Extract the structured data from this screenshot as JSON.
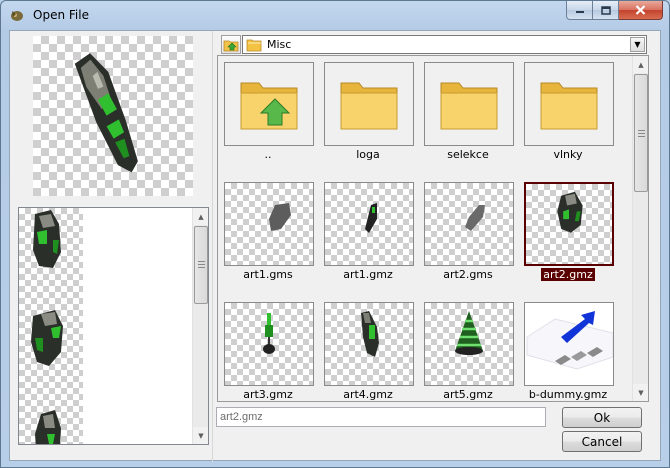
{
  "window": {
    "title": "Open File",
    "controls": {
      "minimize_icon": "minimize-icon",
      "maximize_icon": "maximize-icon",
      "close_icon": "close-icon"
    }
  },
  "toolbar": {
    "up_icon": "folder-up-icon",
    "path": "Misc"
  },
  "files": [
    {
      "name": "..",
      "type": "folder-up"
    },
    {
      "name": "loga",
      "type": "folder"
    },
    {
      "name": "selekce",
      "type": "folder"
    },
    {
      "name": "vlnky",
      "type": "folder"
    },
    {
      "name": "art1.gms",
      "type": "image"
    },
    {
      "name": "art1.gmz",
      "type": "image"
    },
    {
      "name": "art2.gms",
      "type": "image"
    },
    {
      "name": "art2.gmz",
      "type": "image",
      "selected": true
    },
    {
      "name": "art3.gmz",
      "type": "image"
    },
    {
      "name": "art4.gmz",
      "type": "image"
    },
    {
      "name": "art5.gmz",
      "type": "image"
    },
    {
      "name": "b-dummy.gmz",
      "type": "image"
    }
  ],
  "filename_field": {
    "value": "art2.gmz"
  },
  "buttons": {
    "ok": "Ok",
    "cancel": "Cancel"
  },
  "colors": {
    "selection": "#5a0000",
    "folder": "#f5c344",
    "sprite_green": "#2fbf2f"
  }
}
